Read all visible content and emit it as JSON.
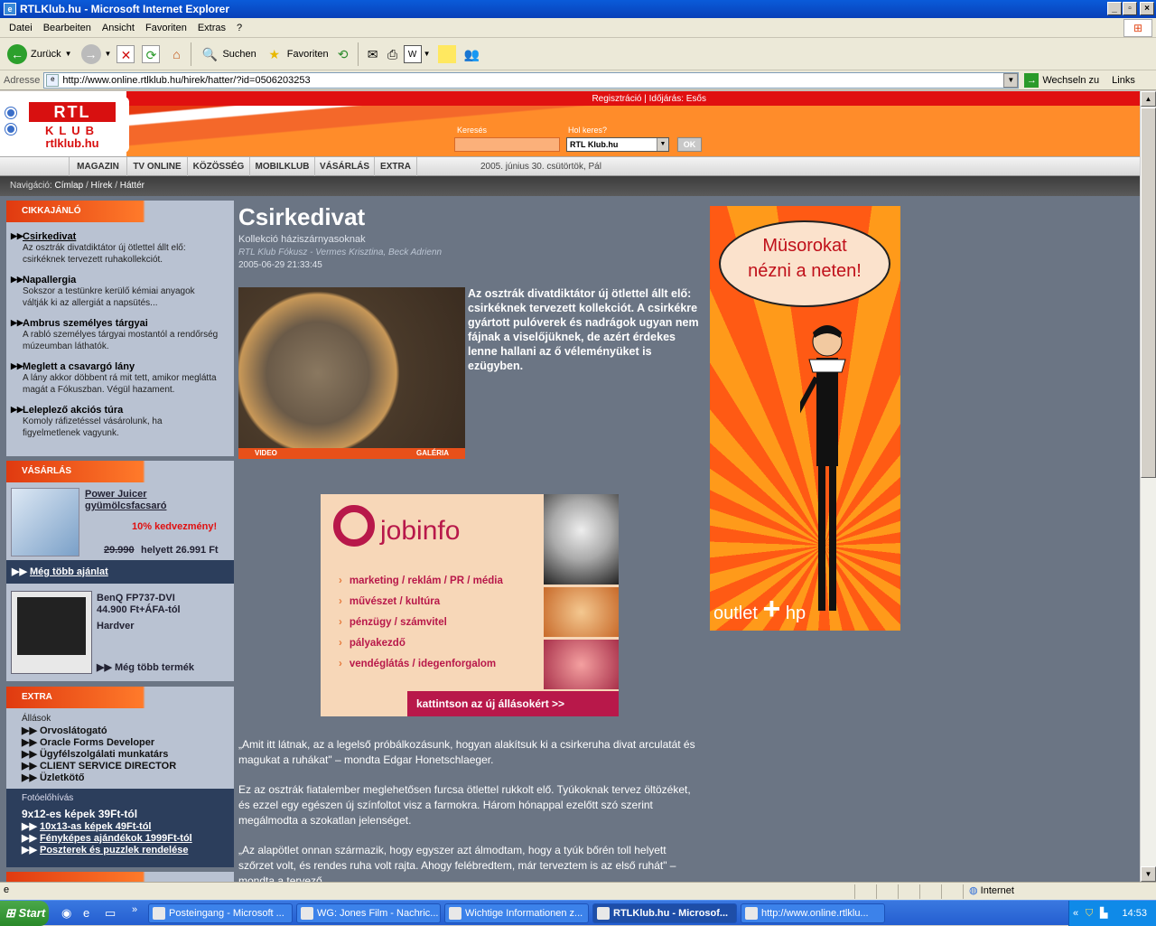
{
  "window": {
    "title": "RTLKlub.hu - Microsoft Internet Explorer"
  },
  "menu": [
    "Datei",
    "Bearbeiten",
    "Ansicht",
    "Favoriten",
    "Extras",
    "?"
  ],
  "toolbar": {
    "back": "Zurück",
    "search": "Suchen",
    "favorites": "Favoriten"
  },
  "address": {
    "label": "Adresse",
    "url": "http://www.online.rtlklub.hu/hirek/hatter/?id=0506203253",
    "go": "Wechseln zu",
    "links": "Links"
  },
  "site": {
    "toplinks": "Regisztráció | Időjárás: Esős",
    "logo": {
      "rtl": "RTL",
      "klub": "KLUB",
      "url": "rtlklub.hu"
    },
    "search_label": "Keresés",
    "where_label": "Hol keres?",
    "where_value": "RTL Klub.hu",
    "ok": "OK",
    "nav": [
      "MAGAZIN",
      "TV ONLINE",
      "KÖZÖSSÉG",
      "MOBILKLUB",
      "VÁSÁRLÁS",
      "EXTRA"
    ],
    "date": "2005. június 30. csütörtök,  Pál",
    "breadcrumb": {
      "label": "Navigáció:",
      "items": [
        "Címlap",
        "Hírek",
        "Háttér"
      ]
    }
  },
  "left": {
    "cikk_header": "CIKKAJÁNLÓ",
    "articles": [
      {
        "title": "Csirkedivat",
        "desc1": "Az osztrák divatdiktátor új ötlettel állt elő:",
        "desc2": "csirkéknek tervezett ruhakollekciót."
      },
      {
        "title": "Napallergia",
        "desc1": "Sokszor a testünkre kerülő kémiai anyagok",
        "desc2": "váltják ki az allergiát a napsütés..."
      },
      {
        "title": "Ambrus személyes tárgyai",
        "desc1": "A rabló személyes tárgyai mostantól a rendőrség",
        "desc2": "múzeumban láthatók."
      },
      {
        "title": "Meglett a csavargó lány",
        "desc1": "A lány akkor döbbent rá mit tett, amikor meglátta",
        "desc2": "magát a Fókuszban. Végül hazament."
      },
      {
        "title": "Leleplező akciós túra",
        "desc1": "Komoly ráfizetéssel vásárolunk, ha",
        "desc2": "figyelmetlenek vagyunk."
      }
    ],
    "shop_header": "VÁSÁRLÁS",
    "shop": {
      "prod1": "Power Juicer",
      "prod1b": "gyümölcsfacsaró",
      "discount": "10% kedvezmény!",
      "oldprice": "29.990",
      "newprice": "helyett 26.991 Ft",
      "more_offers": "Még több ajánlat",
      "prod2": "BenQ FP737-DVI",
      "prod2price": "44.900 Ft+ÁFA-tól",
      "prod2cat": "Hardver",
      "more_products": "Még több termék"
    },
    "extra_header": "EXTRA",
    "extra": {
      "jobs_label": "Állások",
      "jobs": [
        "Orvoslátogató",
        "Oracle Forms Developer",
        "Ügyfélszolgálati munkatárs",
        "CLIENT SERVICE DIRECTOR",
        "Üzletkötő"
      ],
      "photo_label": "Fotóelőhívás",
      "photo_main": "9x12-es képek 39Ft-tól",
      "photo_items": [
        "10x13-as képek 49Ft-tól",
        "Fényképes ajándékok 1999Ft-tól",
        "Poszterek és puzzlek rendelése"
      ]
    }
  },
  "article": {
    "title": "Csirkedivat",
    "subtitle": "Kollekció háziszárnyasoknak",
    "author": "RTL Klub Fókusz - Vermes Krisztina, Beck Adrienn",
    "timestamp": "2005-06-29 21:33:45",
    "photo_video": "VIDEO",
    "photo_gallery": "GALÉRIA",
    "lead": "Az osztrák divatdiktátor új ötlettel állt elő: csirkéknek tervezett kollekciót. A csirkékre gyártott pulóverek és nadrágok ugyan nem fájnak a viselőjüknek, de azért érdekes lenne hallani az ő véleményüket is ezügyben.",
    "p1": "„Amit itt látnak, az a legelső próbálkozásunk, hogyan alakítsuk ki a csirkeruha divat arculatát és magukat a ruhákat\" – mondta Edgar Honetschlaeger.",
    "p2": "Ez az osztrák fiatalember meglehetősen furcsa ötlettel rukkolt elő. Tyúkoknak tervez öltözéket, és ezzel egy egészen új színfoltot visz a farmokra. Három hónappal ezelőtt szó szerint megálmodta a szokatlan jelenséget.",
    "p3": "„Az alapötlet onnan származik, hogy egyszer azt álmodtam, hogy a tyúk bőrén toll helyett szőrzet volt, és rendes ruha volt rajta. Ahogy felébredtem, már terveztem is az első ruhát\" – mondta a tervező."
  },
  "jobad": {
    "logo": "jobinfo",
    "cats": [
      "marketing / reklám / PR / média",
      "művészet / kultúra",
      "pénzügy / számvitel",
      "pályakezdő",
      "vendéglátás / idegenforgalom"
    ],
    "cta": "kattintson az új állásokért >>"
  },
  "promo": {
    "bubble1": "Müsorokat",
    "bubble2": "nézni a neten!",
    "brand": "outlet",
    "brand2": "hp"
  },
  "status": {
    "zone": "Internet"
  },
  "taskbar": {
    "start": "Start",
    "tasks": [
      "Posteingang - Microsoft ...",
      "WG: Jones Film - Nachric...",
      "Wichtige Informationen z...",
      "RTLKlub.hu - Microsof...",
      "http://www.online.rtlklu..."
    ],
    "clock": "14:53"
  },
  "colors": {
    "accent": "#ff6a1a",
    "brand": "#d81010",
    "page_bg": "#6b7584"
  }
}
